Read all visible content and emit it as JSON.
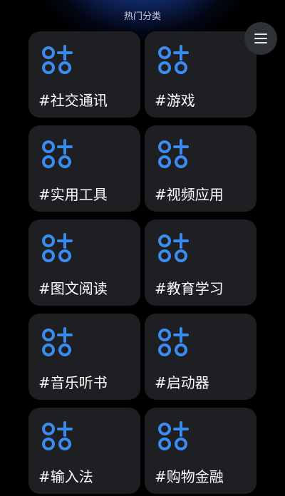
{
  "header": {
    "title": "热门分类",
    "menu_icon": "hamburger-menu-icon"
  },
  "theme": {
    "background": "#000000",
    "card_background": "#1d1f23",
    "icon_color": "#3b8cf0",
    "label_color": "#ffffff",
    "glow_color": "#1f43a8"
  },
  "categories": [
    {
      "label": "#社交通讯",
      "icon": "apps-plus-icon"
    },
    {
      "label": "#游戏",
      "icon": "apps-plus-icon"
    },
    {
      "label": "#实用工具",
      "icon": "apps-plus-icon"
    },
    {
      "label": "#视频应用",
      "icon": "apps-plus-icon"
    },
    {
      "label": "#图文阅读",
      "icon": "apps-plus-icon"
    },
    {
      "label": "#教育学习",
      "icon": "apps-plus-icon"
    },
    {
      "label": "#音乐听书",
      "icon": "apps-plus-icon"
    },
    {
      "label": "#启动器",
      "icon": "apps-plus-icon"
    },
    {
      "label": "#输入法",
      "icon": "apps-plus-icon"
    },
    {
      "label": "#购物金融",
      "icon": "apps-plus-icon"
    }
  ]
}
